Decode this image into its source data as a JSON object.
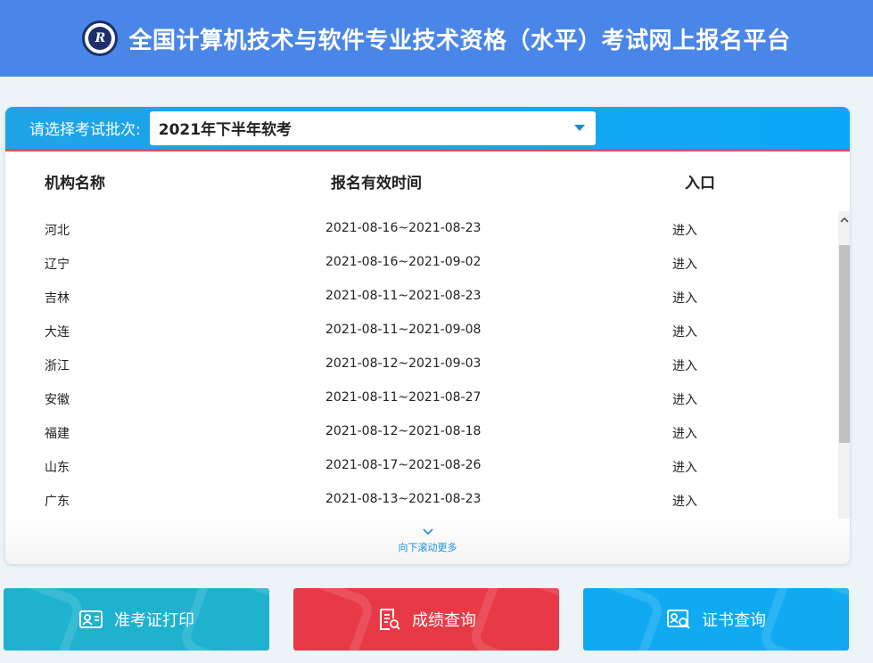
{
  "header": {
    "logo_text": "R",
    "title": "全国计算机技术与软件专业技术资格（水平）考试网上报名平台"
  },
  "batch": {
    "label": "请选择考试批次:",
    "value": "2021年下半年软考"
  },
  "table": {
    "columns": [
      "机构名称",
      "报名有效时间",
      "入口"
    ],
    "rows": [
      {
        "name": "河北",
        "time": "2021-08-16~2021-08-23",
        "entry": "进入"
      },
      {
        "name": "辽宁",
        "time": "2021-08-16~2021-09-02",
        "entry": "进入"
      },
      {
        "name": "吉林",
        "time": "2021-08-11~2021-08-23",
        "entry": "进入"
      },
      {
        "name": "大连",
        "time": "2021-08-11~2021-09-08",
        "entry": "进入"
      },
      {
        "name": "浙江",
        "time": "2021-08-12~2021-09-03",
        "entry": "进入"
      },
      {
        "name": "安徽",
        "time": "2021-08-11~2021-08-27",
        "entry": "进入"
      },
      {
        "name": "福建",
        "time": "2021-08-12~2021-08-18",
        "entry": "进入"
      },
      {
        "name": "山东",
        "time": "2021-08-17~2021-08-26",
        "entry": "进入"
      },
      {
        "name": "广东",
        "time": "2021-08-13~2021-08-23",
        "entry": "进入"
      }
    ]
  },
  "more": {
    "text": "向下滚动更多",
    "icon": "chevron-down-icon"
  },
  "buttons": {
    "admission": {
      "label": "准考证打印",
      "icon": "id-card-icon",
      "color": "#1fb2cf"
    },
    "score": {
      "label": "成绩查询",
      "icon": "document-search-icon",
      "color": "#e83a46"
    },
    "certificate": {
      "label": "证书查询",
      "icon": "certificate-search-icon",
      "color": "#10aaf2"
    }
  },
  "colors": {
    "header_bg": "#4a86e8",
    "card_top_bg": "#14a8f2",
    "accent_line": "#e84b5a"
  }
}
